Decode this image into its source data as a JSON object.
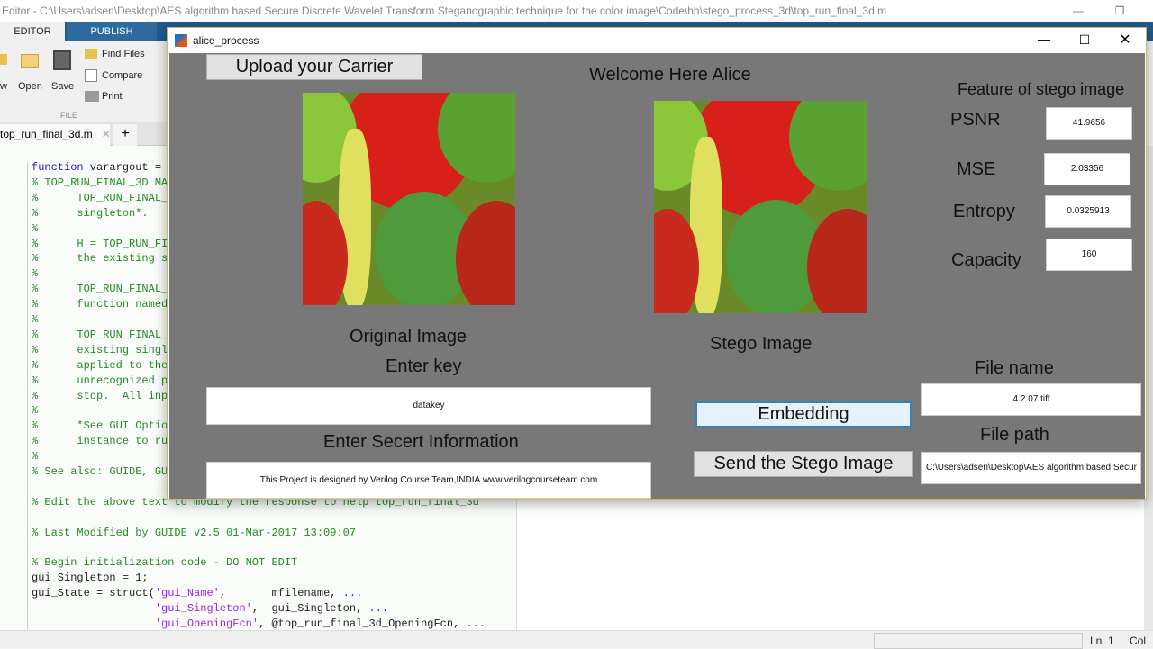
{
  "app": {
    "title": "Editor - C:\\Users\\adsen\\Desktop\\AES algorithm based Secure Discrete Wavelet Transform Steganographic technique for the color image\\Code\\hh\\stego_process_3d\\top_run_final_3d.m",
    "tabs": [
      "EDITOR",
      "PUBLISH"
    ],
    "ribbon": {
      "new": "w",
      "open": "Open",
      "save": "Save",
      "find_files": "Find Files",
      "compare": "Compare",
      "print": "Print",
      "section": "FILE"
    },
    "file_tab": "top_run_final_3d.m",
    "status": {
      "ln_label": "Ln",
      "ln": "1",
      "col_label": "Col"
    }
  },
  "code": [
    {
      "t": "function varargout = ",
      "c": "kw2"
    },
    {
      "t": "% TOP_RUN_FINAL_3D MA",
      "c": "cm"
    },
    {
      "t": "%      TOP_RUN_FINAL_",
      "c": "cm"
    },
    {
      "t": "%      singleton*.",
      "c": "cm"
    },
    {
      "t": "%",
      "c": "cm"
    },
    {
      "t": "%      H = TOP_RUN_FI",
      "c": "cm"
    },
    {
      "t": "%      the existing s",
      "c": "cm"
    },
    {
      "t": "%",
      "c": "cm"
    },
    {
      "t": "%      TOP_RUN_FINAL_",
      "c": "cm"
    },
    {
      "t": "%      function named",
      "c": "cm"
    },
    {
      "t": "%",
      "c": "cm"
    },
    {
      "t": "%      TOP_RUN_FINAL_",
      "c": "cm"
    },
    {
      "t": "%      existing singl",
      "c": "cm"
    },
    {
      "t": "%      applied to the",
      "c": "cm"
    },
    {
      "t": "%      unrecognized p",
      "c": "cm"
    },
    {
      "t": "%      stop.  All inp",
      "c": "cm"
    },
    {
      "t": "%",
      "c": "cm"
    },
    {
      "t": "%      *See GUI Optio",
      "c": "cm"
    },
    {
      "t": "%      instance to ru",
      "c": "cm"
    },
    {
      "t": "%",
      "c": "cm"
    },
    {
      "t": "% See also: GUIDE, GU",
      "c": "cm"
    },
    {
      "t": "",
      "c": ""
    },
    {
      "t": "% Edit the above text to modify the response to help top_run_final_3d",
      "c": "cm"
    },
    {
      "t": "",
      "c": ""
    },
    {
      "t": "% Last Modified by GUIDE v2.5 01-Mar-2017 13:09:07",
      "c": "cm"
    },
    {
      "t": "",
      "c": ""
    },
    {
      "t": "% Begin initialization code - DO NOT EDIT",
      "c": "cm"
    },
    {
      "t": "gui_Singleton = 1;",
      "c": ""
    },
    {
      "t": "gui_State = struct('gui_Name',       mfilename, ...",
      "c": ""
    },
    {
      "t": "                   'gui_Singleton',  gui_Singleton, ...",
      "c": ""
    },
    {
      "t": "                   'gui_OpeningFcn', @top_run_final_3d_OpeningFcn, ...",
      "c": ""
    }
  ],
  "dialog": {
    "title": "alice_process",
    "upload_button": "Upload your Carrier",
    "welcome": "Welcome Here Alice",
    "original_label": "Original Image",
    "stego_label": "Stego Image",
    "features_title": "Feature of stego image",
    "features": [
      {
        "label": "PSNR",
        "value": "41.9656"
      },
      {
        "label": "MSE",
        "value": "2.03356"
      },
      {
        "label": "Entropy",
        "value": "0.0325913"
      },
      {
        "label": "Capacity",
        "value": "160"
      }
    ],
    "key_label": "Enter key",
    "key_value": "datakey",
    "secret_label": "Enter Secert Information",
    "secret_value": "This Project is designed by Verilog Course Team,INDIA.www.verilogcourseteam.com",
    "embed_button": "Embedding",
    "send_button": "Send the Stego Image",
    "filename_label": "File name",
    "filename_value": "4.2.07.tiff",
    "filepath_label": "File path",
    "filepath_value": "C:\\Users\\adsen\\Desktop\\AES algorithm based Secur"
  }
}
